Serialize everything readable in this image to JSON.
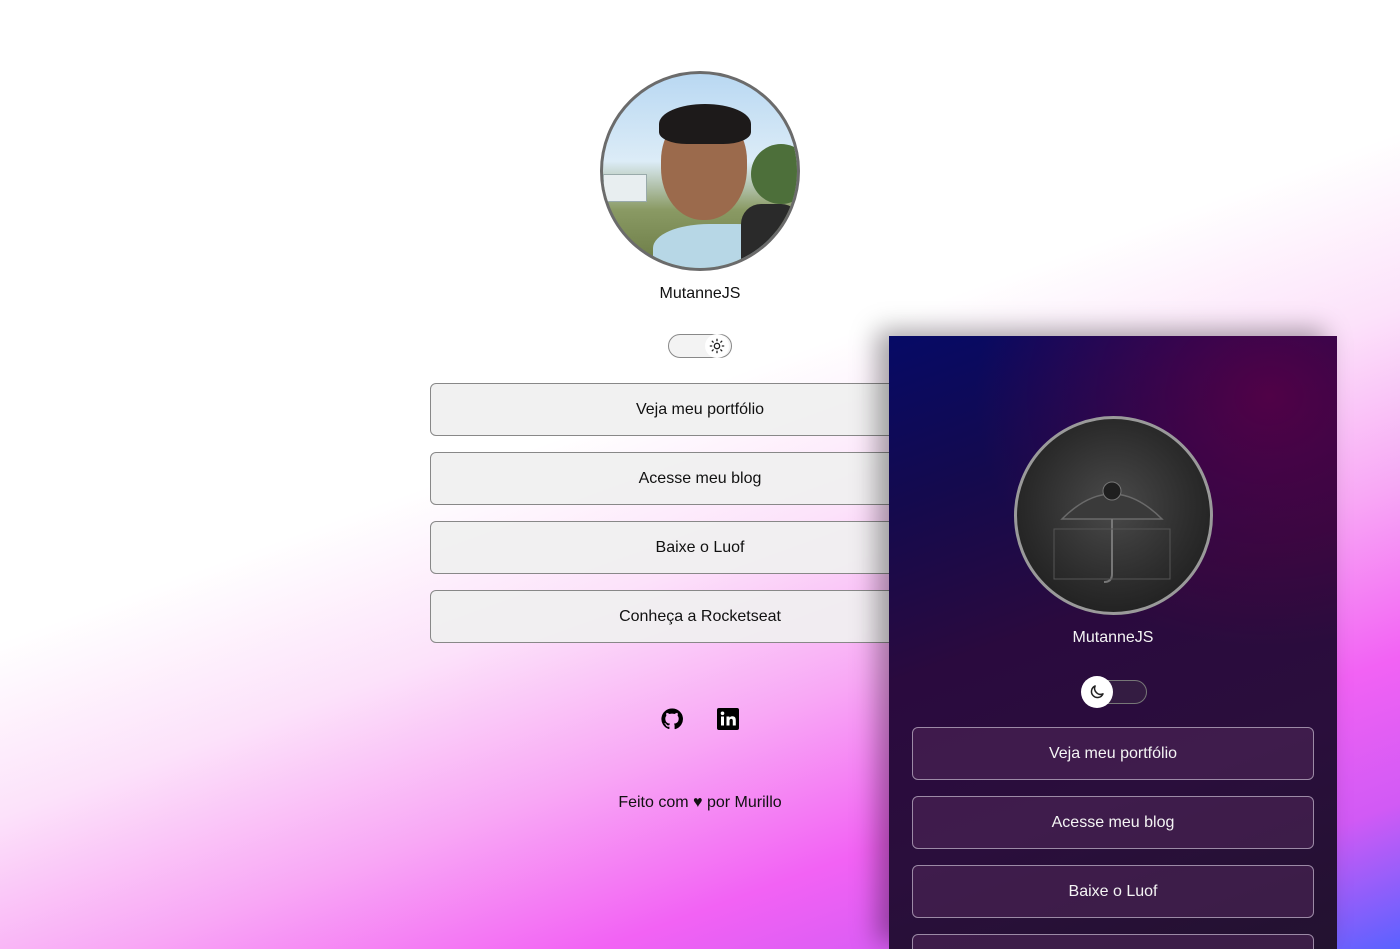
{
  "light": {
    "name": "MutanneJS",
    "theme_toggle": {
      "state": "light",
      "icon": "sun-icon"
    },
    "buttons": [
      {
        "label": "Veja meu portfólio"
      },
      {
        "label": "Acesse meu blog"
      },
      {
        "label": "Baixe o Luof"
      },
      {
        "label": "Conheça a Rocketseat"
      }
    ],
    "socials": [
      {
        "icon": "github-icon"
      },
      {
        "icon": "linkedin-icon"
      }
    ],
    "footer": "Feito com ♥ por Murillo"
  },
  "dark": {
    "name": "MutanneJS",
    "theme_toggle": {
      "state": "dark",
      "icon": "moon-icon"
    },
    "buttons": [
      {
        "label": "Veja meu portfólio"
      },
      {
        "label": "Acesse meu blog"
      },
      {
        "label": "Baixe o Luof"
      },
      {
        "label": ""
      }
    ]
  },
  "colors": {
    "accent_pink": "#f262f4",
    "accent_blue": "#5a62ff",
    "dark_bg": "#140a4e"
  }
}
